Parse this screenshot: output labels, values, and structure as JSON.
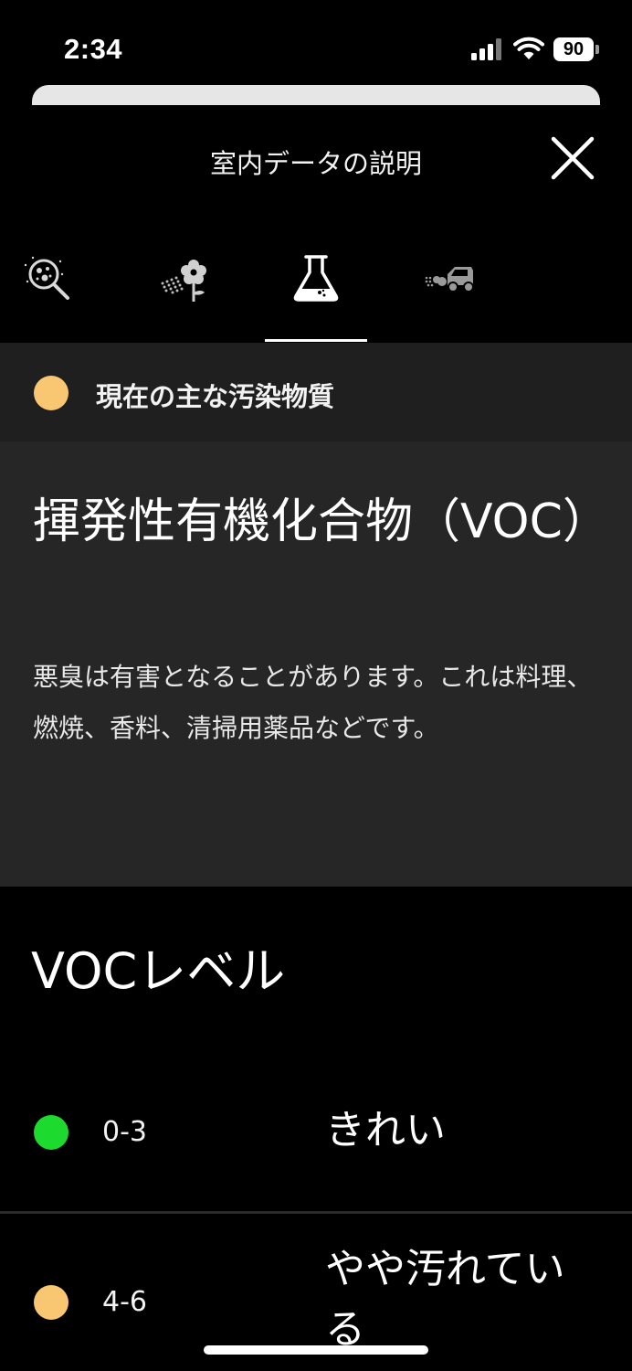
{
  "status_bar": {
    "time": "2:34",
    "battery": "90"
  },
  "header": {
    "title": "室内データの説明"
  },
  "tabs": [
    {
      "icon": "particle-magnifier-icon",
      "selected": false
    },
    {
      "icon": "pollen-flower-icon",
      "selected": false
    },
    {
      "icon": "flask-icon",
      "selected": true
    },
    {
      "icon": "car-exhaust-icon",
      "selected": false
    }
  ],
  "pollutant": {
    "label": "現在の主な汚染物質",
    "color": "#F9C771"
  },
  "info": {
    "title": "揮発性有機化合物（VOC）",
    "description": "悪臭は有害となることがあります。これは料理、燃焼、香料、清掃用薬品などです。"
  },
  "levels": {
    "title": "VOCレベル",
    "items": [
      {
        "range": "0-3",
        "label": "きれい",
        "color": "#1DDB2E"
      },
      {
        "range": "4-6",
        "label": "やや汚れている",
        "color": "#F9C771"
      }
    ]
  },
  "colors": {
    "background": "#000000",
    "card": "#262626",
    "bar": "#1F1F1F"
  }
}
